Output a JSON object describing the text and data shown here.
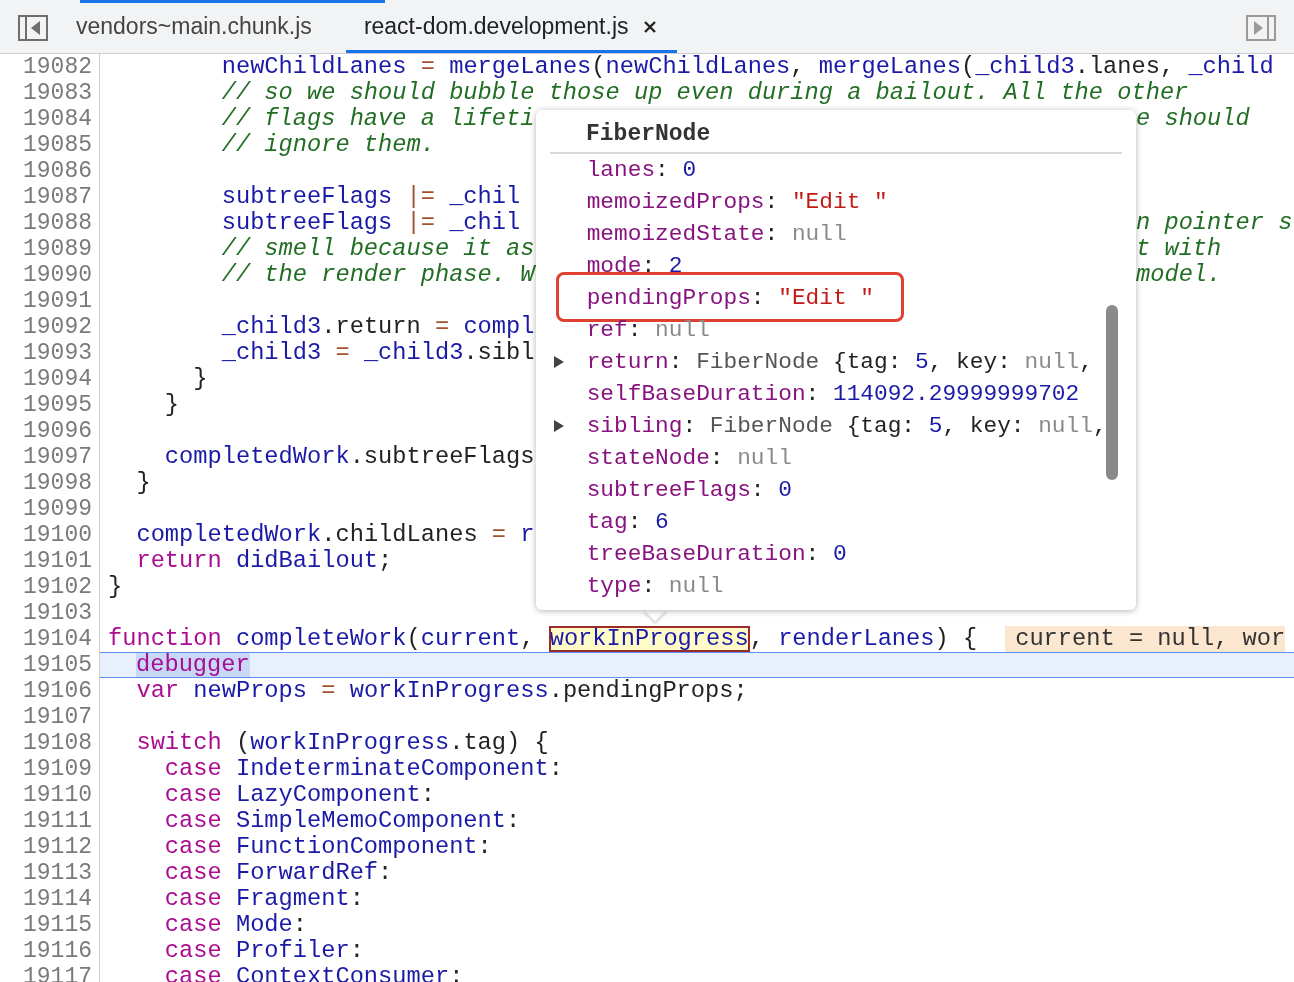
{
  "tabs": [
    {
      "label": "vendors~main.chunk.js",
      "selected": false,
      "closable": false
    },
    {
      "label": "react-dom.development.js",
      "selected": true,
      "closable": true
    }
  ],
  "lines": [
    {
      "number": "19082",
      "paused": false,
      "segments": [
        {
          "kind": "code",
          "tokens": [
            {
              "kind": "ident",
              "text": "        newChildLanes"
            },
            {
              "kind": "op",
              "text": " = "
            },
            {
              "kind": "ident",
              "text": "mergeLanes"
            },
            {
              "kind": "punc",
              "text": "("
            },
            {
              "kind": "ident",
              "text": "newChildLanes"
            },
            {
              "kind": "punc",
              "text": ", "
            },
            {
              "kind": "ident",
              "text": "mergeLanes"
            },
            {
              "kind": "punc",
              "text": "("
            },
            {
              "kind": "ident",
              "text": "_child3"
            },
            {
              "kind": "punc",
              "text": ".lanes, "
            },
            {
              "kind": "ident",
              "text": "_child"
            }
          ]
        }
      ]
    },
    {
      "number": "19083",
      "paused": false,
      "segments": [
        {
          "kind": "code",
          "tokens": [
            {
              "kind": "comment",
              "text": "        // so we should bubble those up even during a bailout. All the other"
            }
          ]
        }
      ]
    },
    {
      "number": "19084",
      "paused": false,
      "segments": [
        {
          "kind": "code",
          "tokens": [
            {
              "kind": "comment",
              "text": "        // flags have a lifeti"
            }
          ]
        }
      ],
      "tail": [
        {
          "kind": "comment",
          "text": "e should"
        }
      ]
    },
    {
      "number": "19085",
      "paused": false,
      "segments": [
        {
          "kind": "code",
          "tokens": [
            {
              "kind": "comment",
              "text": "        // ignore them."
            }
          ]
        }
      ]
    },
    {
      "number": "19086",
      "paused": false
    },
    {
      "number": "19087",
      "paused": false,
      "segments": [
        {
          "kind": "code",
          "tokens": [
            {
              "kind": "ident",
              "text": "        subtreeFlags"
            },
            {
              "kind": "op",
              "text": " |= "
            },
            {
              "kind": "ident",
              "text": "_chil"
            }
          ]
        }
      ]
    },
    {
      "number": "19088",
      "paused": false,
      "segments": [
        {
          "kind": "code",
          "tokens": [
            {
              "kind": "ident",
              "text": "        subtreeFlags"
            },
            {
              "kind": "op",
              "text": " |= "
            },
            {
              "kind": "ident",
              "text": "_chil"
            }
          ]
        }
      ],
      "tail": [
        {
          "kind": "comment",
          "text": "n pointer s"
        }
      ]
    },
    {
      "number": "19089",
      "paused": false,
      "segments": [
        {
          "kind": "code",
          "tokens": [
            {
              "kind": "comment",
              "text": "        // smell because it as"
            }
          ]
        }
      ],
      "tail": [
        {
          "kind": "comment",
          "text": "t with"
        }
      ]
    },
    {
      "number": "19090",
      "paused": false,
      "segments": [
        {
          "kind": "code",
          "tokens": [
            {
              "kind": "comment",
              "text": "        // the render phase. W"
            }
          ]
        }
      ],
      "tail": [
        {
          "kind": "comment",
          "text": "model."
        }
      ]
    },
    {
      "number": "19091",
      "paused": false
    },
    {
      "number": "19092",
      "paused": false,
      "segments": [
        {
          "kind": "code",
          "tokens": [
            {
              "kind": "ident",
              "text": "        _child3"
            },
            {
              "kind": "punc",
              "text": ".return"
            },
            {
              "kind": "op",
              "text": " = "
            },
            {
              "kind": "ident",
              "text": "compl"
            }
          ]
        }
      ]
    },
    {
      "number": "19093",
      "paused": false,
      "segments": [
        {
          "kind": "code",
          "tokens": [
            {
              "kind": "ident",
              "text": "        _child3"
            },
            {
              "kind": "op",
              "text": " = "
            },
            {
              "kind": "ident",
              "text": "_child3"
            },
            {
              "kind": "punc",
              "text": ".sibl"
            }
          ]
        }
      ]
    },
    {
      "number": "19094",
      "paused": false,
      "segments": [
        {
          "kind": "code",
          "tokens": [
            {
              "kind": "punc",
              "text": "      }"
            }
          ]
        }
      ]
    },
    {
      "number": "19095",
      "paused": false,
      "segments": [
        {
          "kind": "code",
          "tokens": [
            {
              "kind": "punc",
              "text": "    }"
            }
          ]
        }
      ]
    },
    {
      "number": "19096",
      "paused": false
    },
    {
      "number": "19097",
      "paused": false,
      "segments": [
        {
          "kind": "code",
          "tokens": [
            {
              "kind": "ident",
              "text": "    completedWork"
            },
            {
              "kind": "punc",
              "text": ".subtreeFlags"
            }
          ]
        }
      ]
    },
    {
      "number": "19098",
      "paused": false,
      "segments": [
        {
          "kind": "code",
          "tokens": [
            {
              "kind": "punc",
              "text": "  }"
            }
          ]
        }
      ]
    },
    {
      "number": "19099",
      "paused": false
    },
    {
      "number": "19100",
      "paused": false,
      "segments": [
        {
          "kind": "code",
          "tokens": [
            {
              "kind": "ident",
              "text": "  completedWork"
            },
            {
              "kind": "punc",
              "text": ".childLanes"
            },
            {
              "kind": "op",
              "text": " = "
            },
            {
              "kind": "ident",
              "text": "r"
            }
          ]
        }
      ]
    },
    {
      "number": "19101",
      "paused": false,
      "segments": [
        {
          "kind": "code",
          "tokens": [
            {
              "kind": "kw",
              "text": "  return"
            },
            {
              "kind": "ident",
              "text": " didBailout"
            },
            {
              "kind": "punc",
              "text": ";"
            }
          ]
        }
      ]
    },
    {
      "number": "19102",
      "paused": false,
      "segments": [
        {
          "kind": "code",
          "tokens": [
            {
              "kind": "punc",
              "text": "}"
            }
          ]
        }
      ]
    },
    {
      "number": "19103",
      "paused": false
    },
    {
      "number": "19104",
      "paused": false,
      "segments": [
        {
          "kind": "code",
          "tokens": [
            {
              "kind": "kw",
              "text": "function"
            },
            {
              "kind": "ident",
              "text": " completeWork"
            },
            {
              "kind": "punc",
              "text": "("
            },
            {
              "kind": "ident",
              "text": "current"
            },
            {
              "kind": "punc",
              "text": ", "
            }
          ]
        },
        {
          "kind": "hover",
          "text": "workInProgress"
        },
        {
          "kind": "code",
          "tokens": [
            {
              "kind": "punc",
              "text": ", "
            },
            {
              "kind": "ident",
              "text": "renderLanes"
            },
            {
              "kind": "punc",
              "text": ") {"
            }
          ]
        },
        {
          "kind": "inline_value",
          "text": "current = null, wor"
        }
      ]
    },
    {
      "number": "19105",
      "paused": true,
      "segments": [
        {
          "kind": "paused",
          "text": "debugger"
        }
      ]
    },
    {
      "number": "19106",
      "paused": false,
      "segments": [
        {
          "kind": "code",
          "tokens": [
            {
              "kind": "kw",
              "text": "  var"
            },
            {
              "kind": "ident",
              "text": " newProps"
            },
            {
              "kind": "op",
              "text": " = "
            },
            {
              "kind": "ident",
              "text": "workInProgress"
            },
            {
              "kind": "punc",
              "text": ".pendingProps;"
            }
          ]
        }
      ]
    },
    {
      "number": "19107",
      "paused": false
    },
    {
      "number": "19108",
      "paused": false,
      "segments": [
        {
          "kind": "code",
          "tokens": [
            {
              "kind": "kw",
              "text": "  switch"
            },
            {
              "kind": "punc",
              "text": " ("
            },
            {
              "kind": "ident",
              "text": "workInProgress"
            },
            {
              "kind": "punc",
              "text": ".tag) {"
            }
          ]
        }
      ]
    },
    {
      "number": "19109",
      "paused": false,
      "segments": [
        {
          "kind": "code",
          "tokens": [
            {
              "kind": "kw",
              "text": "    case"
            },
            {
              "kind": "ident",
              "text": " IndeterminateComponent"
            },
            {
              "kind": "punc",
              "text": ":"
            }
          ]
        }
      ]
    },
    {
      "number": "19110",
      "paused": false,
      "segments": [
        {
          "kind": "code",
          "tokens": [
            {
              "kind": "kw",
              "text": "    case"
            },
            {
              "kind": "ident",
              "text": " LazyComponent"
            },
            {
              "kind": "punc",
              "text": ":"
            }
          ]
        }
      ]
    },
    {
      "number": "19111",
      "paused": false,
      "segments": [
        {
          "kind": "code",
          "tokens": [
            {
              "kind": "kw",
              "text": "    case"
            },
            {
              "kind": "ident",
              "text": " SimpleMemoComponent"
            },
            {
              "kind": "punc",
              "text": ":"
            }
          ]
        }
      ]
    },
    {
      "number": "19112",
      "paused": false,
      "segments": [
        {
          "kind": "code",
          "tokens": [
            {
              "kind": "kw",
              "text": "    case"
            },
            {
              "kind": "ident",
              "text": " FunctionComponent"
            },
            {
              "kind": "punc",
              "text": ":"
            }
          ]
        }
      ]
    },
    {
      "number": "19113",
      "paused": false,
      "segments": [
        {
          "kind": "code",
          "tokens": [
            {
              "kind": "kw",
              "text": "    case"
            },
            {
              "kind": "ident",
              "text": " ForwardRef"
            },
            {
              "kind": "punc",
              "text": ":"
            }
          ]
        }
      ]
    },
    {
      "number": "19114",
      "paused": false,
      "segments": [
        {
          "kind": "code",
          "tokens": [
            {
              "kind": "kw",
              "text": "    case"
            },
            {
              "kind": "ident",
              "text": " Fragment"
            },
            {
              "kind": "punc",
              "text": ":"
            }
          ]
        }
      ]
    },
    {
      "number": "19115",
      "paused": false,
      "segments": [
        {
          "kind": "code",
          "tokens": [
            {
              "kind": "kw",
              "text": "    case"
            },
            {
              "kind": "ident",
              "text": " Mode"
            },
            {
              "kind": "punc",
              "text": ":"
            }
          ]
        }
      ]
    },
    {
      "number": "19116",
      "paused": false,
      "segments": [
        {
          "kind": "code",
          "tokens": [
            {
              "kind": "kw",
              "text": "    case"
            },
            {
              "kind": "ident",
              "text": " Profiler"
            },
            {
              "kind": "punc",
              "text": ":"
            }
          ]
        }
      ]
    },
    {
      "number": "19117",
      "paused": false,
      "segments": [
        {
          "kind": "code",
          "tokens": [
            {
              "kind": "kw",
              "text": "    case"
            },
            {
              "kind": "ident",
              "text": " ContextConsumer"
            },
            {
              "kind": "punc",
              "text": ":"
            }
          ]
        }
      ]
    }
  ],
  "popover": {
    "title": "FiberNode",
    "properties": [
      {
        "name": "lanes",
        "expandable": false,
        "highlighted": false,
        "value": [
          {
            "kind": "punc",
            "text": ": "
          },
          {
            "kind": "number",
            "text": "0"
          }
        ]
      },
      {
        "name": "memoizedProps",
        "expandable": false,
        "highlighted": false,
        "value": [
          {
            "kind": "punc",
            "text": ": "
          },
          {
            "kind": "string",
            "text": "\"Edit \""
          }
        ]
      },
      {
        "name": "memoizedState",
        "expandable": false,
        "highlighted": false,
        "value": [
          {
            "kind": "punc",
            "text": ": "
          },
          {
            "kind": "null",
            "text": "null"
          }
        ]
      },
      {
        "name": "mode",
        "expandable": false,
        "highlighted": false,
        "value": [
          {
            "kind": "punc",
            "text": ": "
          },
          {
            "kind": "number",
            "text": "2"
          }
        ]
      },
      {
        "name": "pendingProps",
        "expandable": false,
        "highlighted": true,
        "value": [
          {
            "kind": "punc",
            "text": ": "
          },
          {
            "kind": "string",
            "text": "\"Edit \""
          }
        ]
      },
      {
        "name": "ref",
        "expandable": false,
        "highlighted": false,
        "value": [
          {
            "kind": "punc",
            "text": ": "
          },
          {
            "kind": "null",
            "text": "null"
          }
        ]
      },
      {
        "name": "return",
        "expandable": true,
        "highlighted": false,
        "value": [
          {
            "kind": "punc",
            "text": ": "
          },
          {
            "kind": "object",
            "text": "FiberNode "
          },
          {
            "kind": "punc",
            "text": "{tag: "
          },
          {
            "kind": "number",
            "text": "5"
          },
          {
            "kind": "punc",
            "text": ", key: "
          },
          {
            "kind": "null",
            "text": "null"
          },
          {
            "kind": "punc",
            "text": ","
          }
        ]
      },
      {
        "name": "selfBaseDuration",
        "expandable": false,
        "highlighted": false,
        "value": [
          {
            "kind": "punc",
            "text": ": "
          },
          {
            "kind": "number",
            "text": "114092.29999999702"
          }
        ]
      },
      {
        "name": "sibling",
        "expandable": true,
        "highlighted": false,
        "value": [
          {
            "kind": "punc",
            "text": ": "
          },
          {
            "kind": "object",
            "text": "FiberNode "
          },
          {
            "kind": "punc",
            "text": "{tag: "
          },
          {
            "kind": "number",
            "text": "5"
          },
          {
            "kind": "punc",
            "text": ", key: "
          },
          {
            "kind": "null",
            "text": "null"
          },
          {
            "kind": "punc",
            "text": ","
          }
        ]
      },
      {
        "name": "stateNode",
        "expandable": false,
        "highlighted": false,
        "value": [
          {
            "kind": "punc",
            "text": ": "
          },
          {
            "kind": "null",
            "text": "null"
          }
        ]
      },
      {
        "name": "subtreeFlags",
        "expandable": false,
        "highlighted": false,
        "value": [
          {
            "kind": "punc",
            "text": ": "
          },
          {
            "kind": "number",
            "text": "0"
          }
        ]
      },
      {
        "name": "tag",
        "expandable": false,
        "highlighted": false,
        "value": [
          {
            "kind": "punc",
            "text": ": "
          },
          {
            "kind": "number",
            "text": "6"
          }
        ]
      },
      {
        "name": "treeBaseDuration",
        "expandable": false,
        "highlighted": false,
        "value": [
          {
            "kind": "punc",
            "text": ": "
          },
          {
            "kind": "number",
            "text": "0"
          }
        ]
      },
      {
        "name": "type",
        "expandable": false,
        "highlighted": false,
        "value": [
          {
            "kind": "punc",
            "text": ": "
          },
          {
            "kind": "null",
            "text": "null"
          }
        ]
      }
    ]
  }
}
